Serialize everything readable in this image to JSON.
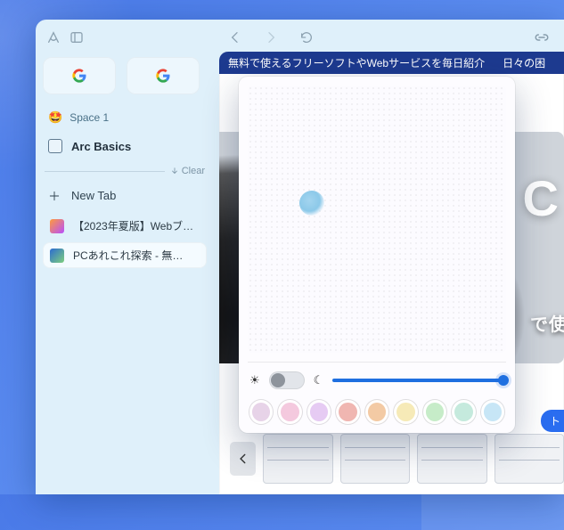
{
  "sidebar": {
    "space": {
      "emoji": "🤩",
      "name": "Space 1"
    },
    "folder": {
      "label": "Arc Basics"
    },
    "clear_label": "Clear",
    "newtab_label": "New Tab",
    "tabs": [
      {
        "title": "【2023年夏版】Webブ…",
        "active": false
      },
      {
        "title": "PCあれこれ探索 - 無…",
        "active": true
      }
    ]
  },
  "banner": {
    "left": "無料で使えるフリーソフトやWebサービスを毎日紹介",
    "right": "日々の困"
  },
  "page": {
    "headline_fragment": "C",
    "subline_fragment": "で使"
  },
  "thumb_button": {
    "label": "ト"
  },
  "popover": {
    "dark_mode": false,
    "brightness_pct": 100,
    "swatches": [
      "#e7d3e8",
      "#f4c9de",
      "#e6cbf3",
      "#f0b6b1",
      "#f3caa4",
      "#f6eab7",
      "#c6ecc8",
      "#c5eadd",
      "#c7e6f6"
    ]
  },
  "icons": {
    "arc": "arc-logo-icon",
    "sidebar_toggle": "sidebar-toggle-icon"
  }
}
